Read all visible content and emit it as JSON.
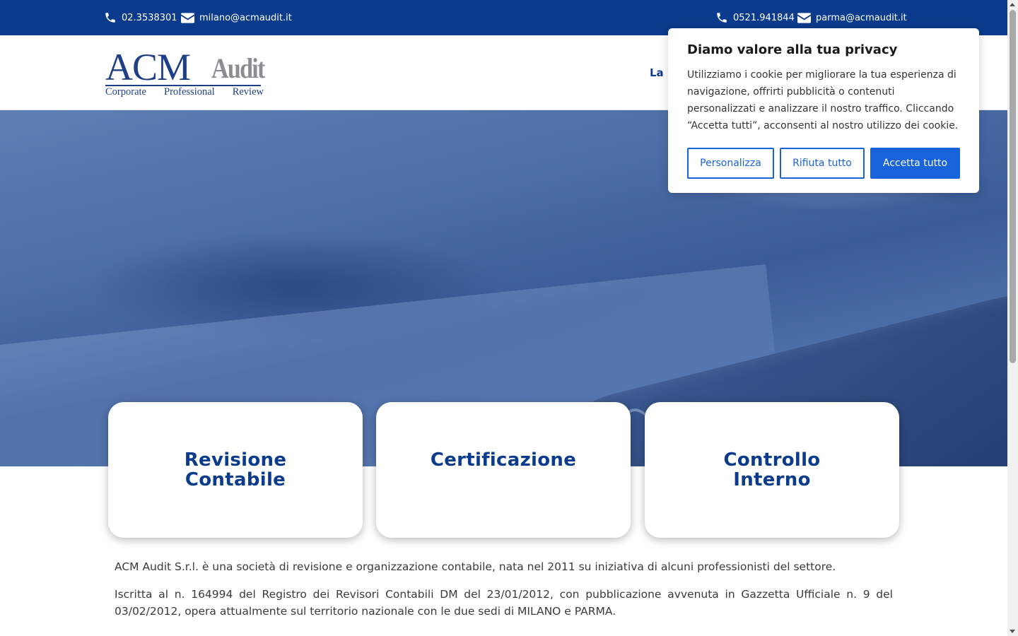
{
  "contacts": {
    "milano_phone": "02.3538301",
    "milano_email": "milano@acmaudit.it",
    "parma_phone": "0521.941844",
    "parma_email": "parma@acmaudit.it"
  },
  "logo": {
    "main": "ACM",
    "audit": "Audit",
    "tagline": [
      "Corporate",
      "Professional",
      "Review"
    ]
  },
  "nav": {
    "visible_fragment": "La S"
  },
  "cards": [
    {
      "title": "Revisione Contabile"
    },
    {
      "title": "Certificazione"
    },
    {
      "title": "Controllo Interno"
    }
  ],
  "content": {
    "para1": "ACM Audit S.r.l. è una società di revisione e organizzazione contabile, nata nel 2011 su iniziativa di alcuni professionisti del settore.",
    "para2": "Iscritta al n. 164994 del Registro dei Revisori Contabili DM del 23/01/2012, con pubblicazione avvenuta in Gazzetta Ufficiale n. 9 del 03/02/2012, opera attualmente sul territorio nazionale con le due sedi di MILANO e PARMA."
  },
  "cookie_banner": {
    "title": "Diamo valore alla tua privacy",
    "text": "Utilizziamo i cookie per migliorare la tua esperienza di navigazione, offrirti pubblicità o contenuti personalizzati e analizzare il nostro traffico. Cliccando “Accetta tutti”, acconsenti al nostro utilizzo dei cookie.",
    "customize_label": "Personalizza",
    "reject_label": "Rifiuta tutto",
    "accept_label": "Accetta tutto"
  },
  "colors": {
    "brand_blue": "#0b3b8c",
    "accent_blue": "#1863dc"
  }
}
